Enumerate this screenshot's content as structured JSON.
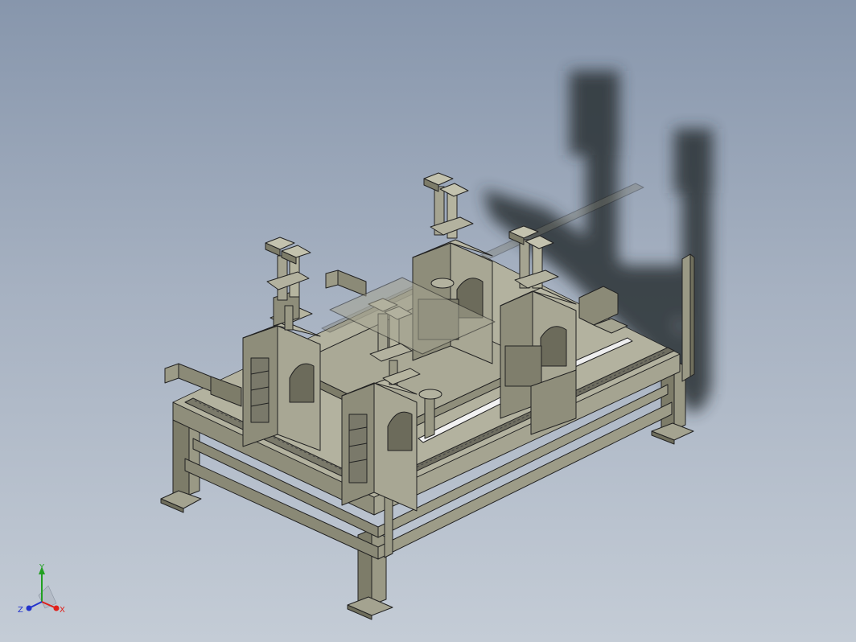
{
  "view": {
    "background_top": "#8796ac",
    "background_bottom": "#c4ccd6",
    "model_color": "#8c8b77",
    "model_edge_color": "#222222",
    "shadow_color": "#2c3036"
  },
  "triad": {
    "x_label": "X",
    "y_label": "Y",
    "z_label": "Z",
    "x_color": "#e0201a",
    "y_color": "#22a022",
    "z_color": "#2233cc"
  }
}
